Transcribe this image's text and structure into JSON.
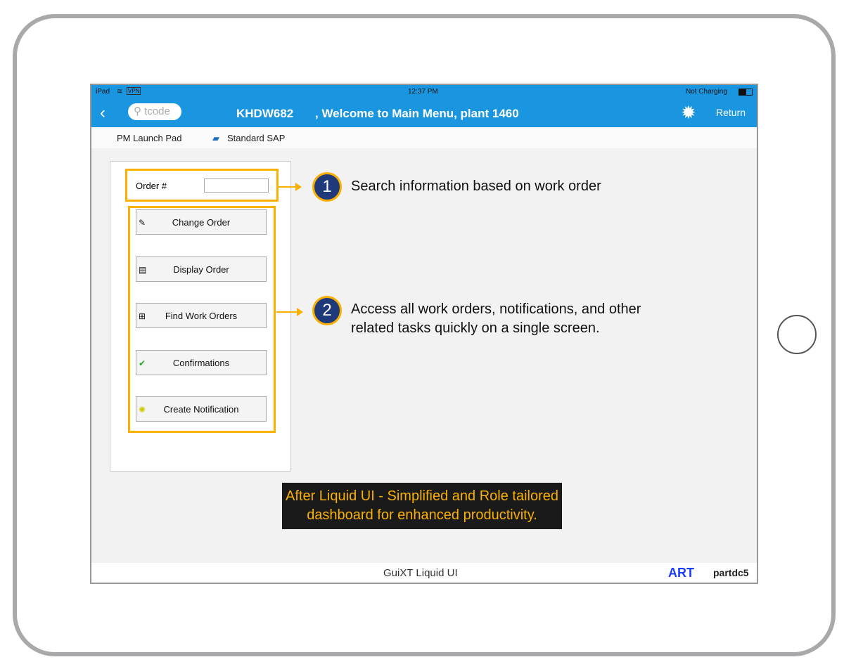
{
  "status": {
    "device": "iPad",
    "vpn": "VPN",
    "time": "12:37 PM",
    "battery": "Not Charging"
  },
  "nav": {
    "search_placeholder": "tcode",
    "user": "KHDW682",
    "title": ", Welcome to Main Menu, plant 1460",
    "return": "Return"
  },
  "tabs": [
    {
      "label": "PM Launch Pad"
    },
    {
      "label": "Standard SAP"
    }
  ],
  "form": {
    "order_label": "Order #",
    "order_value": ""
  },
  "buttons": [
    {
      "label": "Change Order",
      "icon": "edit-icon"
    },
    {
      "label": "Display Order",
      "icon": "document-icon"
    },
    {
      "label": "Find Work Orders",
      "icon": "binoculars-icon"
    },
    {
      "label": "Confirmations",
      "icon": "checkmark-icon"
    },
    {
      "label": "Create Notification",
      "icon": "lightbulb-icon"
    }
  ],
  "callouts": [
    {
      "num": "1",
      "text": "Search information based on work order"
    },
    {
      "num": "2",
      "line1": "Access all work orders, notifications, and other",
      "line2": "related tasks quickly on a single screen."
    }
  ],
  "caption": {
    "line1": "After Liquid UI - Simplified and Role tailored",
    "line2": "dashboard for enhanced productivity."
  },
  "footer": {
    "center": "GuiXT Liquid UI",
    "art": "ART",
    "server": "partdc5"
  },
  "colors": {
    "accent": "#1a95e0",
    "highlight": "#f9b000",
    "badge": "#1e3a7a"
  }
}
